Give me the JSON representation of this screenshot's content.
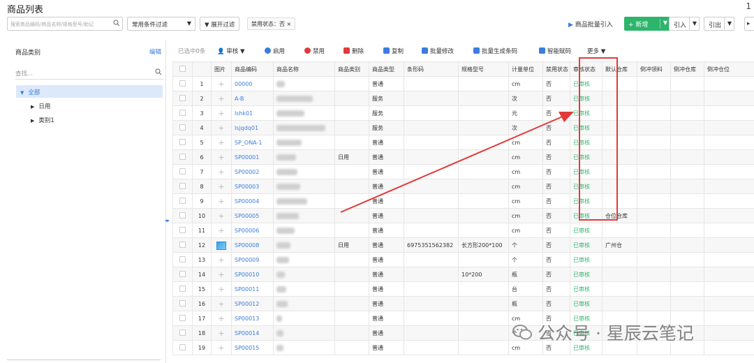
{
  "header": {
    "title": "商品列表",
    "search_placeholder": "搜索商品编码/商品名称/规格型号/助记",
    "filter_select": "常用条件过滤",
    "expand_filter": "展开过滤",
    "status_chip": "禁用状态：否",
    "batch_import": "商品批量引入",
    "new_button": "+ 新增",
    "import_button": "引入",
    "export_button": "引出",
    "corner_mark": "1"
  },
  "sidebar": {
    "title": "商品类别",
    "edit": "编辑",
    "search_placeholder": "查找...",
    "root": "全部",
    "items": [
      "日用",
      "类别1"
    ]
  },
  "actions": {
    "selected": "已选中0条",
    "audit": "审核",
    "enable": "启用",
    "disable": "禁用",
    "delete": "删除",
    "copy": "复制",
    "batch_edit": "批量修改",
    "batch_barcode": "批量生成条码",
    "smart_code": "智能赋码",
    "more": "更多"
  },
  "table": {
    "columns": [
      "图片",
      "商品编码",
      "商品名称",
      "商品类别",
      "商品类型",
      "条形码",
      "规格型号",
      "计量单位",
      "禁用状态",
      "审核状态",
      "默认仓库",
      "倒冲领料",
      "倒冲仓库",
      "倒冲仓位"
    ],
    "rows": [
      {
        "n": "1",
        "code": "00000",
        "cat": "",
        "type": "普通",
        "barcode": "",
        "spec": "",
        "unit": "cm",
        "disabled": "否",
        "audit": "已审核",
        "wh": ""
      },
      {
        "n": "2",
        "code": "A-B",
        "cat": "",
        "type": "服务",
        "barcode": "",
        "spec": "",
        "unit": "次",
        "disabled": "否",
        "audit": "已审核",
        "wh": ""
      },
      {
        "n": "3",
        "code": "lshk01",
        "cat": "",
        "type": "服务",
        "barcode": "",
        "spec": "",
        "unit": "元",
        "disabled": "否",
        "audit": "已审核",
        "wh": ""
      },
      {
        "n": "4",
        "code": "lsjqdq01",
        "cat": "",
        "type": "服务",
        "barcode": "",
        "spec": "",
        "unit": "次",
        "disabled": "否",
        "audit": "已审核",
        "wh": ""
      },
      {
        "n": "5",
        "code": "SP_ONA-1",
        "cat": "",
        "type": "普通",
        "barcode": "",
        "spec": "",
        "unit": "cm",
        "disabled": "否",
        "audit": "已审核",
        "wh": ""
      },
      {
        "n": "6",
        "code": "SP00001",
        "cat": "日用",
        "type": "普通",
        "barcode": "",
        "spec": "",
        "unit": "cm",
        "disabled": "否",
        "audit": "已审核",
        "wh": ""
      },
      {
        "n": "7",
        "code": "SP00002",
        "cat": "",
        "type": "普通",
        "barcode": "",
        "spec": "",
        "unit": "cm",
        "disabled": "否",
        "audit": "已审核",
        "wh": ""
      },
      {
        "n": "8",
        "code": "SP00003",
        "cat": "",
        "type": "普通",
        "barcode": "",
        "spec": "",
        "unit": "cm",
        "disabled": "否",
        "audit": "已审核",
        "wh": ""
      },
      {
        "n": "9",
        "code": "SP00004",
        "cat": "",
        "type": "普通",
        "barcode": "",
        "spec": "",
        "unit": "cm",
        "disabled": "否",
        "audit": "已审核",
        "wh": ""
      },
      {
        "n": "10",
        "code": "SP00005",
        "cat": "",
        "type": "普通",
        "barcode": "",
        "spec": "",
        "unit": "cm",
        "disabled": "否",
        "audit": "已审核",
        "wh": "仓位仓库"
      },
      {
        "n": "11",
        "code": "SP00006",
        "cat": "",
        "type": "普通",
        "barcode": "",
        "spec": "",
        "unit": "cm",
        "disabled": "否",
        "audit": "已审核",
        "wh": ""
      },
      {
        "n": "12",
        "code": "SP00008",
        "cat": "日用",
        "type": "普通",
        "barcode": "6975351562382",
        "spec": "长方形200*100",
        "unit": "个",
        "disabled": "否",
        "audit": "已审核",
        "wh": "广州仓"
      },
      {
        "n": "13",
        "code": "SP00009",
        "cat": "",
        "type": "普通",
        "barcode": "",
        "spec": "",
        "unit": "个",
        "disabled": "否",
        "audit": "已审核",
        "wh": ""
      },
      {
        "n": "14",
        "code": "SP00010",
        "cat": "",
        "type": "普通",
        "barcode": "",
        "spec": "10*200",
        "unit": "瓶",
        "disabled": "否",
        "audit": "已审核",
        "wh": ""
      },
      {
        "n": "15",
        "code": "SP00011",
        "cat": "",
        "type": "普通",
        "barcode": "",
        "spec": "",
        "unit": "台",
        "disabled": "否",
        "audit": "已审核",
        "wh": ""
      },
      {
        "n": "16",
        "code": "SP00012",
        "cat": "",
        "type": "普通",
        "barcode": "",
        "spec": "",
        "unit": "瓶",
        "disabled": "否",
        "audit": "已审核",
        "wh": ""
      },
      {
        "n": "17",
        "code": "SP00013",
        "cat": "",
        "type": "普通",
        "barcode": "",
        "spec": "",
        "unit": "cm",
        "disabled": "否",
        "audit": "已审核",
        "wh": ""
      },
      {
        "n": "18",
        "code": "SP00014",
        "cat": "",
        "type": "普通",
        "barcode": "",
        "spec": "",
        "unit": "个",
        "disabled": "否",
        "audit": "已审核",
        "wh": ""
      },
      {
        "n": "19",
        "code": "SP00015",
        "cat": "",
        "type": "普通",
        "barcode": "",
        "spec": "",
        "unit": "cm",
        "disabled": "否",
        "audit": "已审核",
        "wh": ""
      }
    ]
  },
  "watermark": "公众号 · 星辰云笔记",
  "colors": {
    "accent": "#3b7ddd",
    "green": "#2db56b",
    "highlight": "#e23a3a"
  }
}
